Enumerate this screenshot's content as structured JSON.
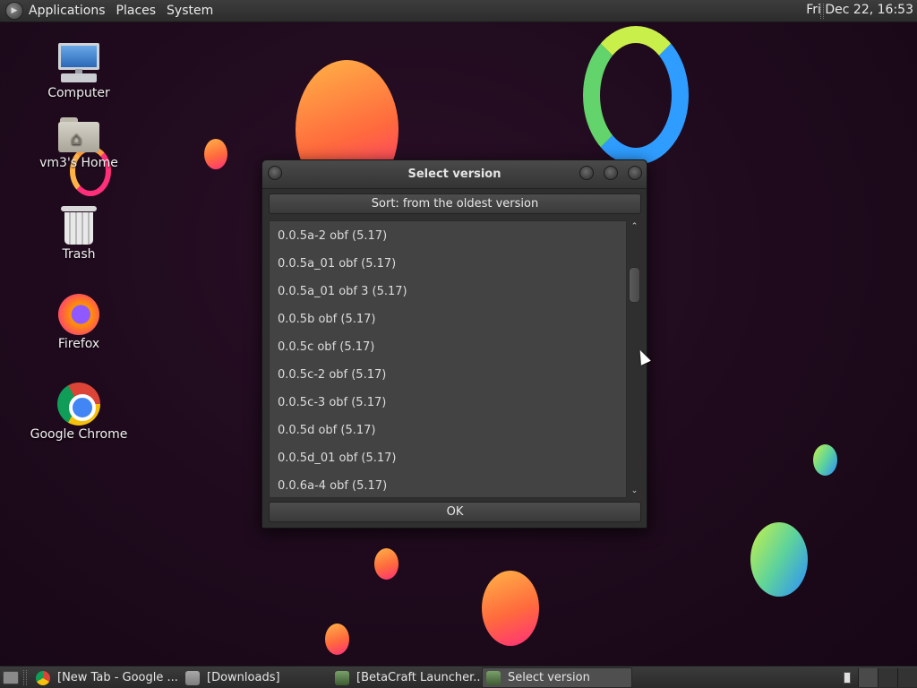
{
  "top_panel": {
    "menus": [
      "Applications",
      "Places",
      "System"
    ],
    "clock": "Fri Dec 22, 16:53"
  },
  "desktop_icons": [
    {
      "label": "Computer",
      "icon": "computer-icon"
    },
    {
      "label": "vm3's Home",
      "icon": "home-folder-icon"
    },
    {
      "label": "Trash",
      "icon": "trash-icon"
    },
    {
      "label": "Firefox",
      "icon": "firefox-icon"
    },
    {
      "label": "Google Chrome",
      "icon": "chrome-icon"
    }
  ],
  "dialog": {
    "title": "Select version",
    "sort_label": "Sort: from the oldest version",
    "versions": [
      "0.0.5a-2 obf (5.17)",
      "0.0.5a_01 obf (5.17)",
      "0.0.5a_01 obf 3 (5.17)",
      "0.0.5b obf (5.17)",
      "0.0.5c obf (5.17)",
      "0.0.5c-2 obf (5.17)",
      "0.0.5c-3 obf (5.17)",
      "0.0.5d obf (5.17)",
      "0.0.5d_01 obf (5.17)",
      "0.0.6a-4 obf (5.17)"
    ],
    "scroll_up": "⌃",
    "scroll_down": "⌄",
    "ok_label": "OK"
  },
  "taskbar": {
    "tasks": [
      {
        "label": "[New Tab - Google ...",
        "icon": "chrome-icon",
        "active": false
      },
      {
        "label": "[Downloads]",
        "icon": "folder-icon",
        "active": false
      },
      {
        "label": "[BetaCraft Launcher...",
        "icon": "betacraft-icon",
        "active": false
      },
      {
        "label": "Select version",
        "icon": "betacraft-icon",
        "active": true
      }
    ]
  },
  "colors": {
    "wallpaper": "#1f0b1c",
    "panel": "#333333",
    "dialog_bg": "#2f2f2f",
    "list_bg": "#434343",
    "accent_orange": "#ff6a3d",
    "accent_green": "#5fd39a"
  }
}
